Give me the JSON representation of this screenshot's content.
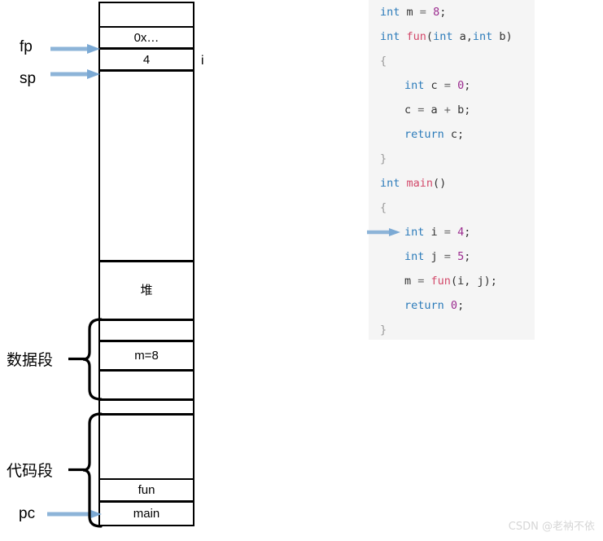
{
  "diagram": {
    "title": "process-memory-layout-with-c-code",
    "stack_cells": [
      {
        "label": "",
        "name": "stack-cell-empty-top"
      },
      {
        "label": "0x…",
        "name": "stack-cell-saved-fp"
      },
      {
        "label": "4",
        "name": "stack-cell-i-value"
      },
      {
        "label": "",
        "name": "stack-cell-free-region"
      }
    ],
    "heap_cell": {
      "label": "堆",
      "name": "heap-cell"
    },
    "data_cells": [
      {
        "label": "",
        "name": "data-cell-empty-upper"
      },
      {
        "label": "m=8",
        "name": "data-cell-m"
      },
      {
        "label": "",
        "name": "data-cell-empty-lower"
      },
      {
        "label": "",
        "name": "data-cell-gap"
      }
    ],
    "code_cells": [
      {
        "label": "",
        "name": "code-cell-empty"
      },
      {
        "label": "fun",
        "name": "code-cell-fun"
      },
      {
        "label": "main",
        "name": "code-cell-main"
      }
    ],
    "pointers": [
      {
        "label": "fp",
        "name": "pointer-fp"
      },
      {
        "label": "sp",
        "name": "pointer-sp"
      },
      {
        "label": "pc",
        "name": "pointer-pc"
      }
    ],
    "segment_labels": [
      {
        "label": "数据段",
        "name": "segment-label-data"
      },
      {
        "label": "代码段",
        "name": "segment-label-code"
      }
    ],
    "side_annotation": {
      "label": "i",
      "name": "stack-annotation-i"
    },
    "colors": {
      "arrow": "#8db4d8",
      "box_border": "#000000",
      "code_panel_bg": "#f5f5f5"
    }
  },
  "code": {
    "language": "c",
    "current_line_index": 9,
    "lines": [
      {
        "indent": 0,
        "tokens": [
          {
            "t": "int",
            "c": "kw"
          },
          {
            "t": " m ",
            "c": "id"
          },
          {
            "t": "=",
            "c": "op"
          },
          {
            "t": " ",
            "c": "pl"
          },
          {
            "t": "8",
            "c": "num"
          },
          {
            "t": ";",
            "c": "id"
          }
        ]
      },
      {
        "indent": 0,
        "tokens": [
          {
            "t": "int",
            "c": "kw"
          },
          {
            "t": " ",
            "c": "pl"
          },
          {
            "t": "fun",
            "c": "fn"
          },
          {
            "t": "(",
            "c": "id"
          },
          {
            "t": "int",
            "c": "kw"
          },
          {
            "t": " a,",
            "c": "id"
          },
          {
            "t": "int",
            "c": "kw"
          },
          {
            "t": " b)",
            "c": "id"
          }
        ]
      },
      {
        "indent": 0,
        "tokens": [
          {
            "t": "{",
            "c": "br"
          }
        ]
      },
      {
        "indent": 1,
        "tokens": [
          {
            "t": "int",
            "c": "kw"
          },
          {
            "t": " c ",
            "c": "id"
          },
          {
            "t": "=",
            "c": "op"
          },
          {
            "t": " ",
            "c": "pl"
          },
          {
            "t": "0",
            "c": "num"
          },
          {
            "t": ";",
            "c": "id"
          }
        ]
      },
      {
        "indent": 1,
        "tokens": [
          {
            "t": "c ",
            "c": "id"
          },
          {
            "t": "=",
            "c": "op"
          },
          {
            "t": " a ",
            "c": "id"
          },
          {
            "t": "+",
            "c": "op"
          },
          {
            "t": " b;",
            "c": "id"
          }
        ]
      },
      {
        "indent": 1,
        "tokens": [
          {
            "t": "return",
            "c": "kw"
          },
          {
            "t": " c;",
            "c": "id"
          }
        ]
      },
      {
        "indent": 0,
        "tokens": [
          {
            "t": "}",
            "c": "br"
          }
        ]
      },
      {
        "indent": 0,
        "tokens": [
          {
            "t": "int",
            "c": "kw"
          },
          {
            "t": " ",
            "c": "pl"
          },
          {
            "t": "main",
            "c": "fn"
          },
          {
            "t": "()",
            "c": "id"
          }
        ]
      },
      {
        "indent": 0,
        "tokens": [
          {
            "t": "{",
            "c": "br"
          }
        ]
      },
      {
        "indent": 1,
        "tokens": [
          {
            "t": "int",
            "c": "kw"
          },
          {
            "t": " i ",
            "c": "id"
          },
          {
            "t": "=",
            "c": "op"
          },
          {
            "t": " ",
            "c": "pl"
          },
          {
            "t": "4",
            "c": "num"
          },
          {
            "t": ";",
            "c": "id"
          }
        ]
      },
      {
        "indent": 1,
        "tokens": [
          {
            "t": "int",
            "c": "kw"
          },
          {
            "t": " j ",
            "c": "id"
          },
          {
            "t": "=",
            "c": "op"
          },
          {
            "t": " ",
            "c": "pl"
          },
          {
            "t": "5",
            "c": "num"
          },
          {
            "t": ";",
            "c": "id"
          }
        ]
      },
      {
        "indent": 1,
        "tokens": [
          {
            "t": "m ",
            "c": "id"
          },
          {
            "t": "=",
            "c": "op"
          },
          {
            "t": " ",
            "c": "pl"
          },
          {
            "t": "fun",
            "c": "fn"
          },
          {
            "t": "(i, j);",
            "c": "id"
          }
        ]
      },
      {
        "indent": 1,
        "tokens": [
          {
            "t": "return",
            "c": "kw"
          },
          {
            "t": " ",
            "c": "pl"
          },
          {
            "t": "0",
            "c": "num"
          },
          {
            "t": ";",
            "c": "id"
          }
        ]
      },
      {
        "indent": 0,
        "tokens": [
          {
            "t": "}",
            "c": "br"
          }
        ]
      }
    ]
  },
  "watermark": {
    "text": "CSDN @老衲不依"
  }
}
